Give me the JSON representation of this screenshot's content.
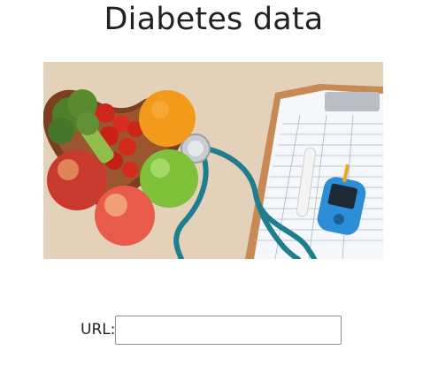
{
  "page": {
    "title": "Diabetes data"
  },
  "hero_image": {
    "icon": "health-food-stethoscope-glucometer-photo",
    "colors": {
      "table": "#e6d3bd",
      "bowl": "#8a4a2a",
      "stethoscope": "#1f7e8e",
      "meter": "#2f8fd8",
      "orange": "#f39a1a",
      "green_apple": "#7fc23a",
      "red_apple": "#e85b4a",
      "tomato": "#d12a1e",
      "broccoli": "#5a8a2e"
    }
  },
  "form": {
    "url_label": "URL:",
    "url_value": "",
    "url_placeholder": ""
  }
}
